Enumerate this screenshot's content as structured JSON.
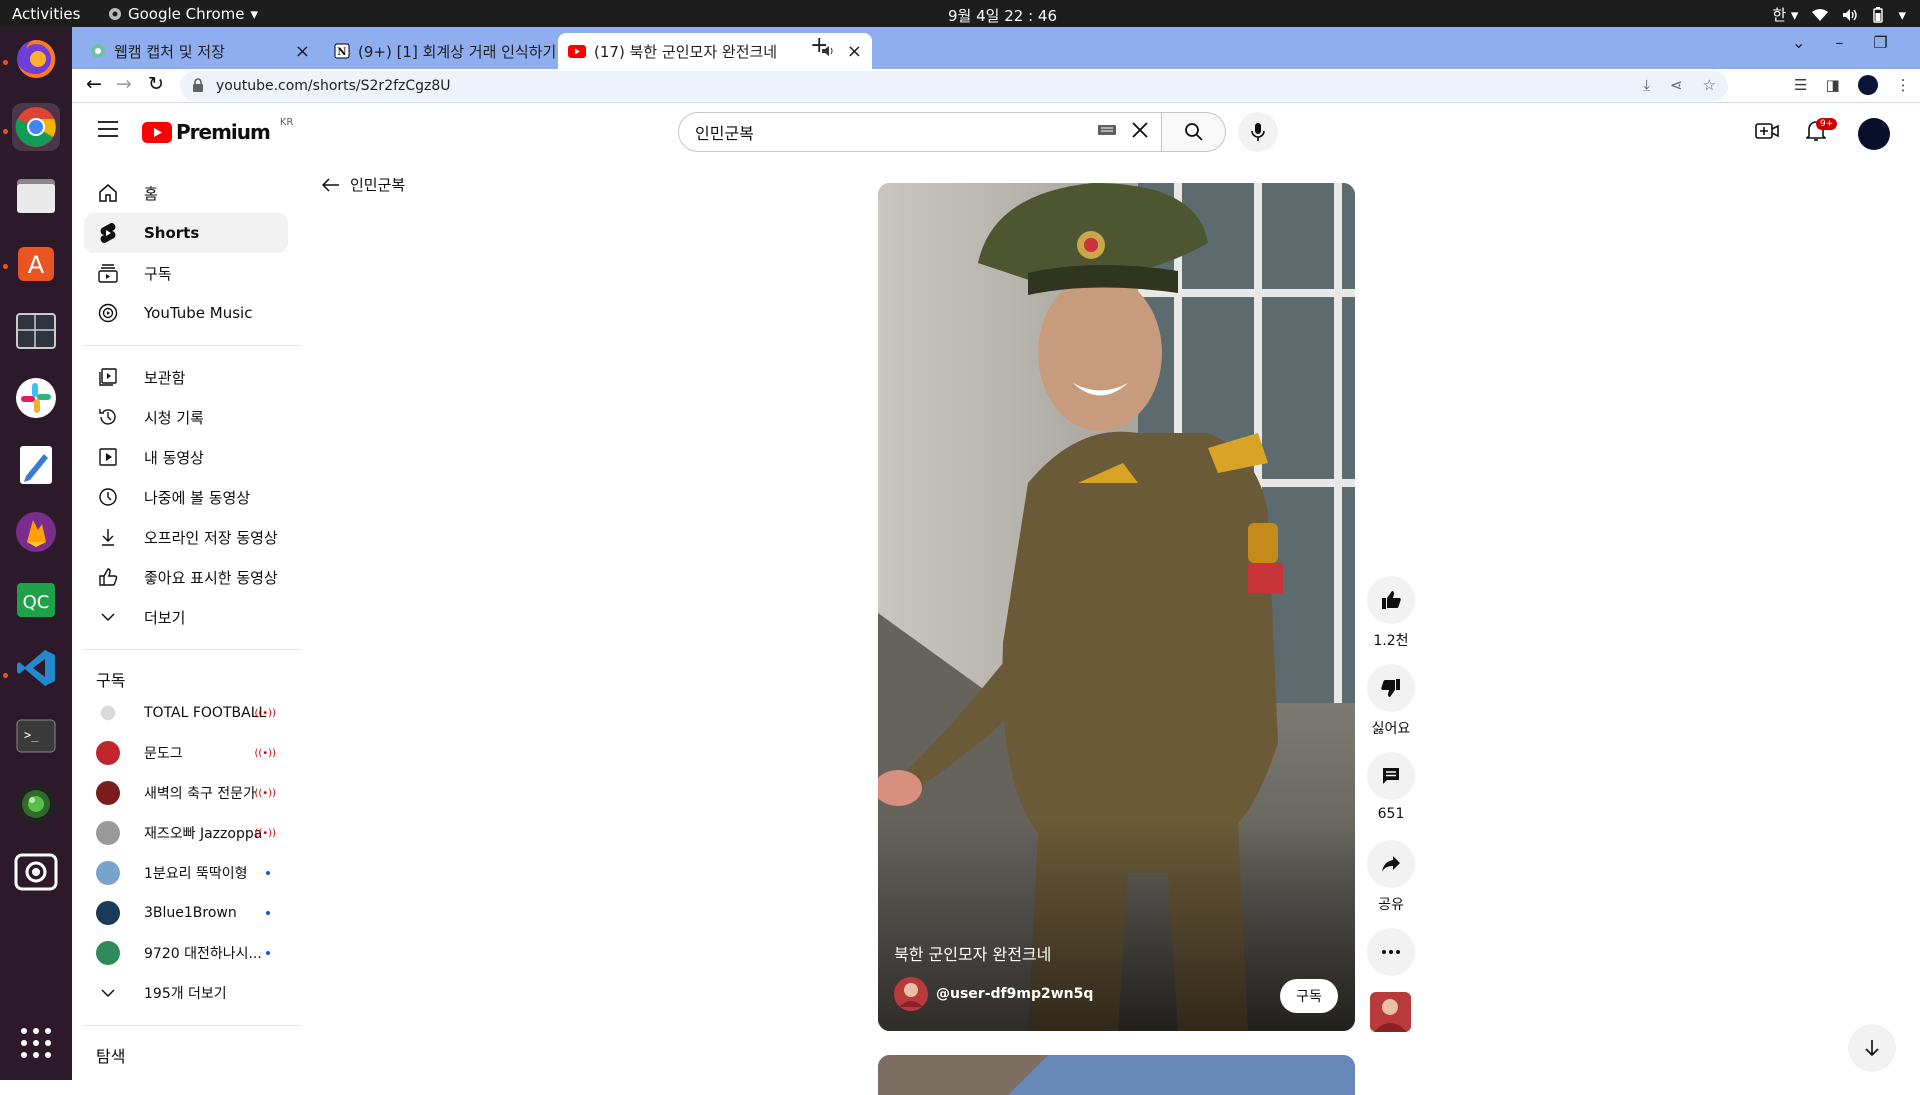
{
  "os": {
    "activities": "Activities",
    "app_name": "Google Chrome",
    "clock": "9월 4일  22 : 46",
    "input_method": "한"
  },
  "browser": {
    "tabs": [
      {
        "title": "웹캠 캡처 및 저장"
      },
      {
        "title": "(9+) [1] 회계상 거래 인식하기"
      },
      {
        "title": "(17) 북한 군인모자 완전크네"
      }
    ],
    "url": "youtube.com/shorts/S2r2fzCgz8U"
  },
  "header": {
    "logo_text": "Premium",
    "region": "KR",
    "search_value": "인민군복",
    "notif_count": "9+"
  },
  "sidebar": {
    "main": [
      {
        "label": "홈",
        "icon": "home-icon"
      },
      {
        "label": "Shorts",
        "icon": "shorts-icon"
      },
      {
        "label": "구독",
        "icon": "subscriptions-icon"
      },
      {
        "label": "YouTube Music",
        "icon": "music-icon"
      }
    ],
    "library": [
      {
        "label": "보관함",
        "icon": "library-icon"
      },
      {
        "label": "시청 기록",
        "icon": "history-icon"
      },
      {
        "label": "내 동영상",
        "icon": "my-videos-icon"
      },
      {
        "label": "나중에 볼 동영상",
        "icon": "watch-later-icon"
      },
      {
        "label": "오프라인 저장 동영상",
        "icon": "download-icon"
      },
      {
        "label": "좋아요 표시한 동영상",
        "icon": "like-icon"
      },
      {
        "label": "더보기",
        "icon": "chevron-down-icon"
      }
    ],
    "subs_title": "구독",
    "subs": [
      {
        "label": "TOTAL FOOTBALL",
        "badge": "live",
        "color": "#d9d9d9"
      },
      {
        "label": "문도그",
        "badge": "live",
        "color": "#c0262d"
      },
      {
        "label": "새벽의 축구 전문가",
        "badge": "live",
        "color": "#7a1d1d"
      },
      {
        "label": "재즈오빠 Jazzoppa",
        "badge": "live",
        "color": "#9a9a9a"
      },
      {
        "label": "1분요리 뚝딱이형",
        "badge": "new",
        "color": "#7aa3c9"
      },
      {
        "label": "3Blue1Brown",
        "badge": "new",
        "color": "#1c3a57"
      },
      {
        "label": "9720 대전하나시...",
        "badge": "new",
        "color": "#2e8b57"
      }
    ],
    "more_subs": "195개 더보기",
    "explore_title": "탐색"
  },
  "back_label": "인민군복",
  "short": {
    "title": "북한 군인모자 완전크네",
    "channel": "@user-df9mp2wn5q",
    "subscribe": "구독",
    "likes": "1.2천",
    "dislike": "싫어요",
    "comments": "651",
    "share": "공유"
  }
}
